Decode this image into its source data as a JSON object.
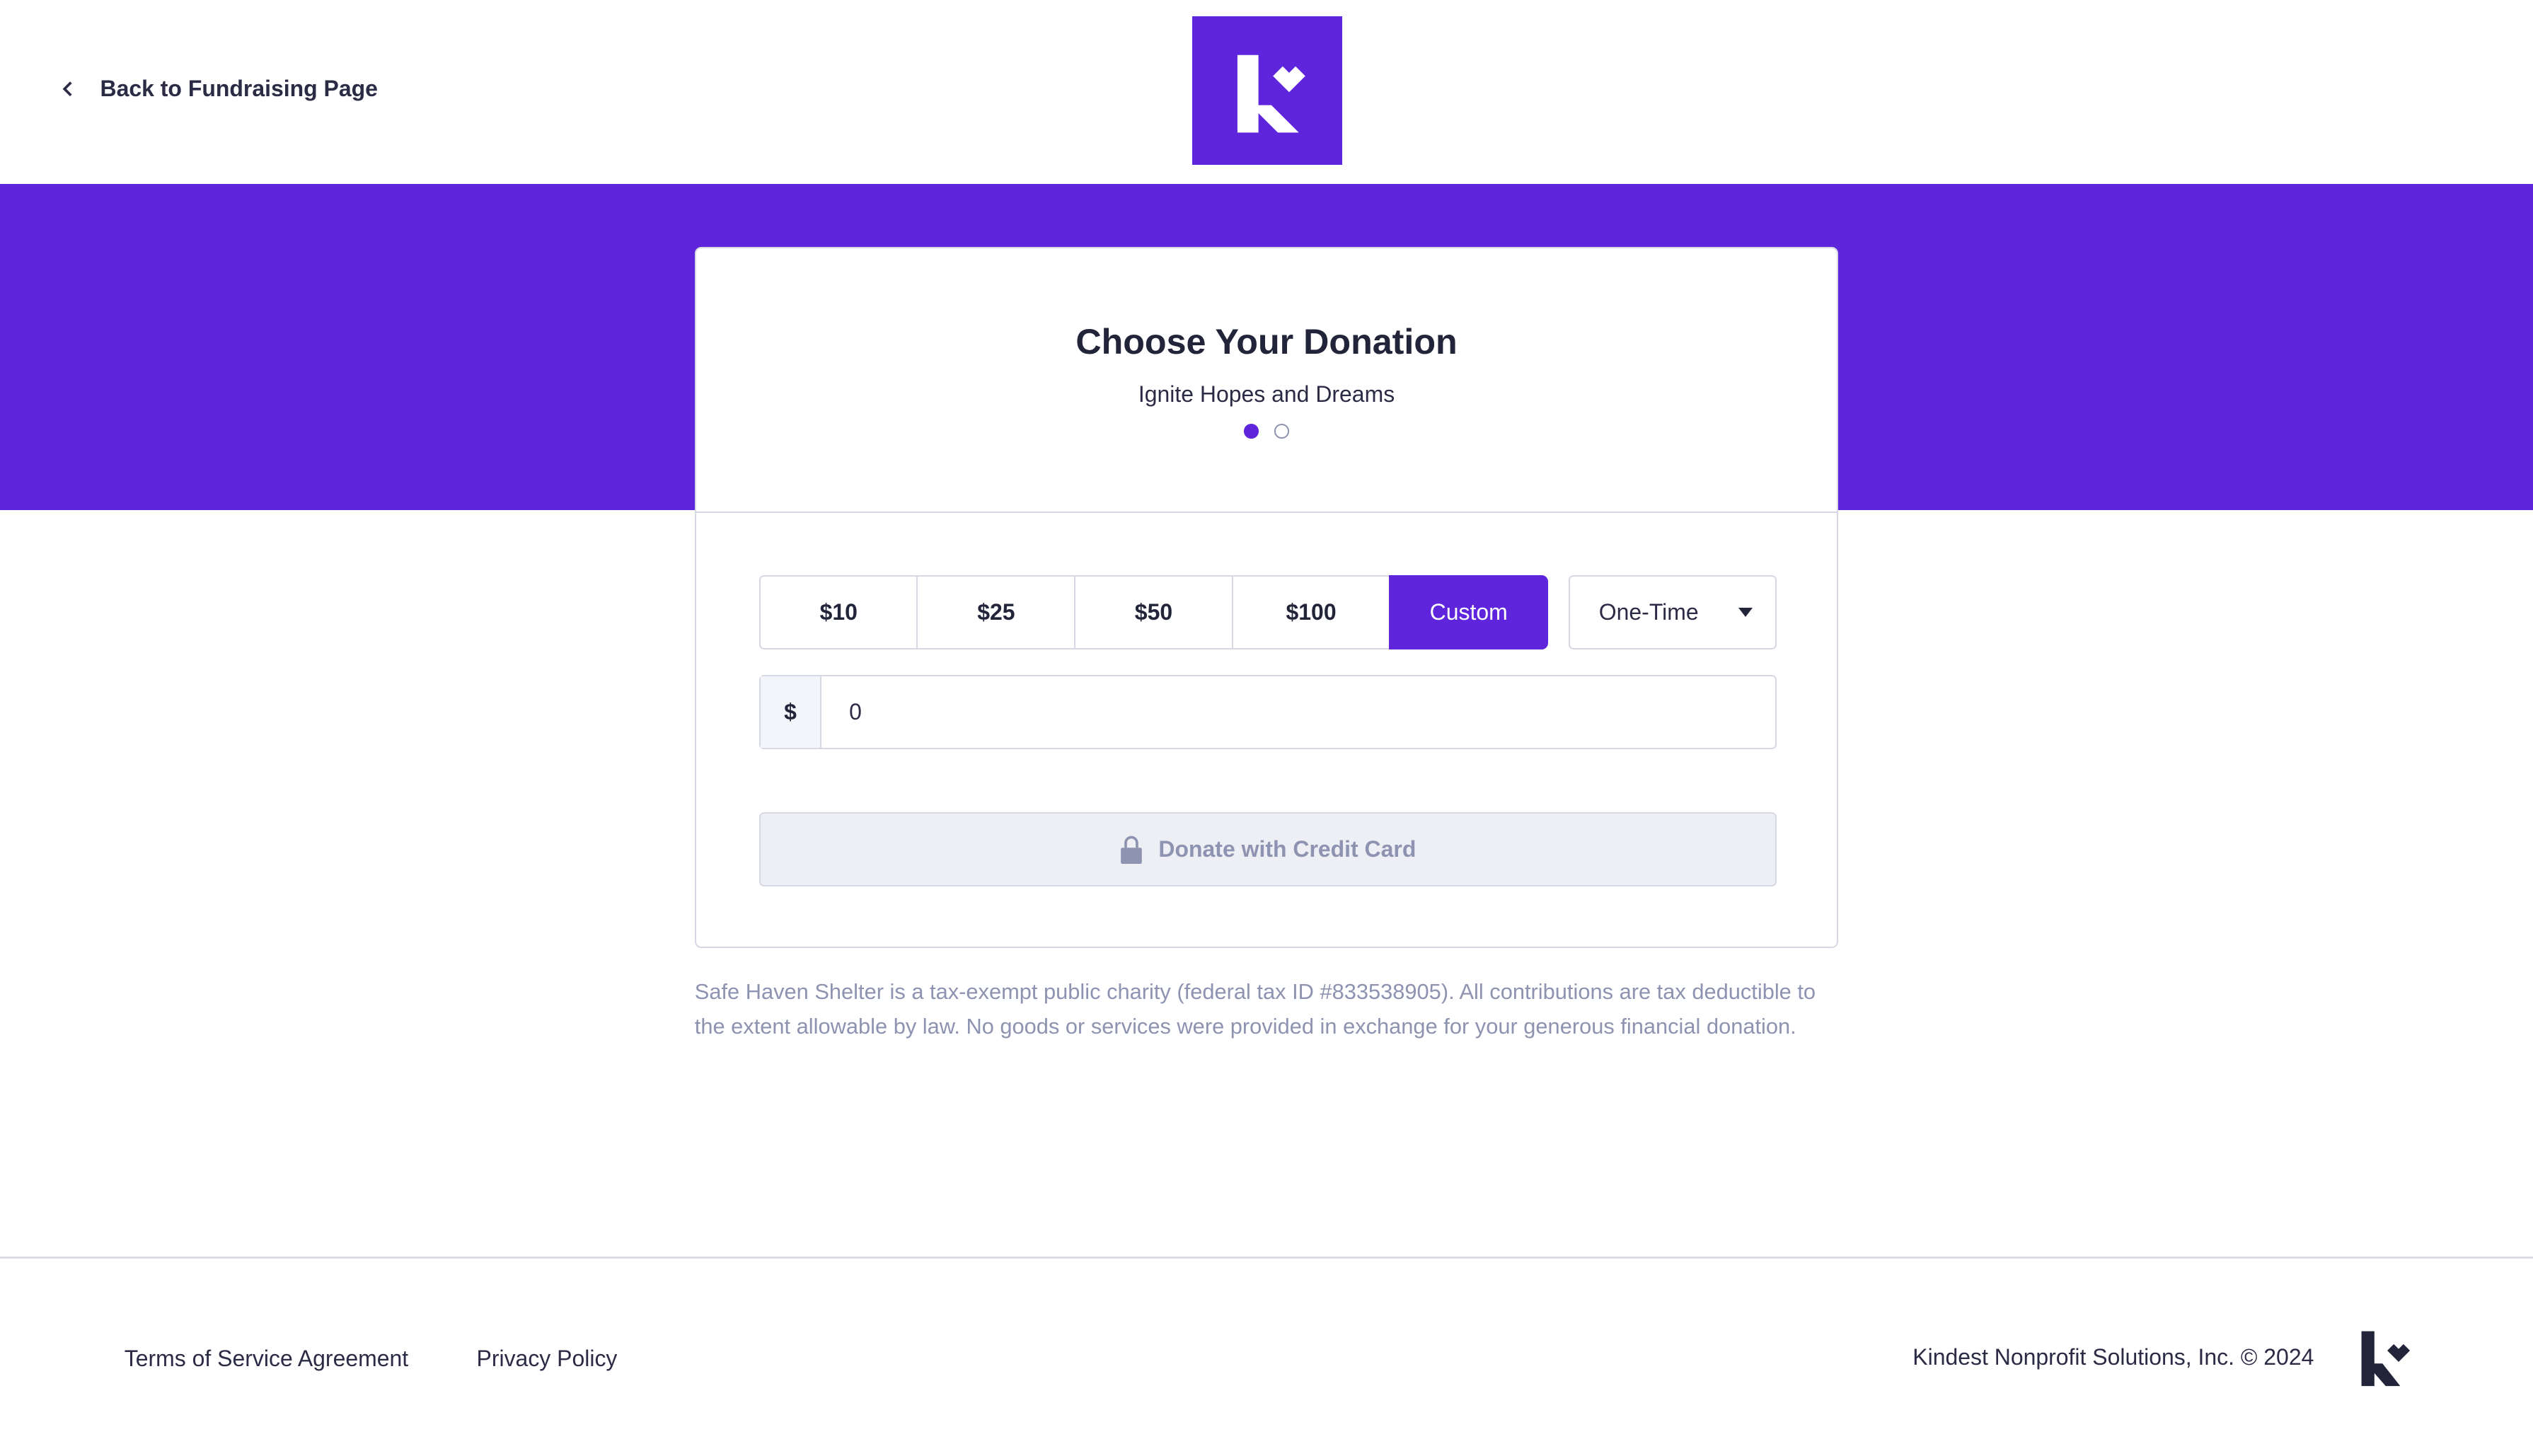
{
  "header": {
    "back_label": "Back to Fundraising Page",
    "logo": "kindest-logo"
  },
  "card": {
    "title": "Choose Your Donation",
    "subtitle": "Ignite Hopes and Dreams",
    "steps_total": 2,
    "step_current": 1
  },
  "amounts": [
    {
      "label": "$10"
    },
    {
      "label": "$25"
    },
    {
      "label": "$50"
    },
    {
      "label": "$100"
    },
    {
      "label": "Custom",
      "selected": true
    }
  ],
  "frequency": {
    "selected": "One-Time"
  },
  "amount_input": {
    "prefix": "$",
    "value": "0"
  },
  "donate_button": {
    "label": "Donate with Credit Card",
    "icon": "lock-icon",
    "disabled": true
  },
  "disclaimer": "Safe Haven Shelter is a tax-exempt public charity (federal tax ID #833538905). All contributions are tax deductible to the extent allowable by law. No goods or services were provided in exchange for your generous financial donation.",
  "footer": {
    "terms": "Terms of Service Agreement",
    "privacy": "Privacy Policy",
    "copyright": "Kindest Nonprofit Solutions, Inc. © 2024"
  },
  "colors": {
    "brand": "#5f25dc",
    "text": "#22243a",
    "muted": "#8d93b0"
  }
}
